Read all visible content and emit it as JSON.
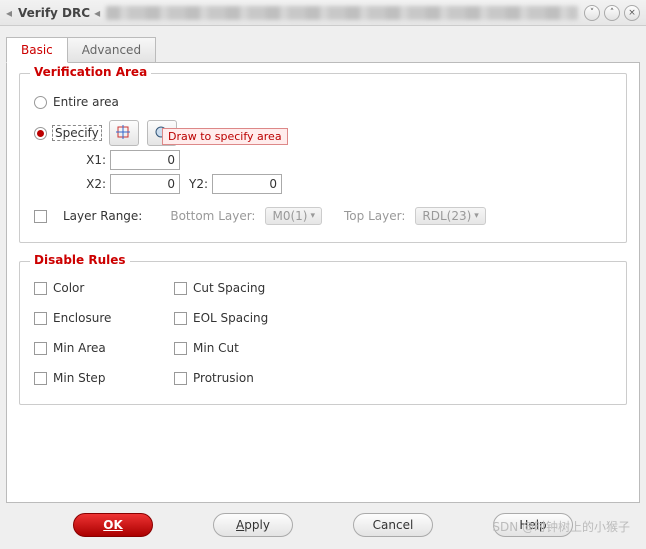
{
  "window": {
    "title": "Verify DRC"
  },
  "tabs": {
    "basic": "Basic",
    "advanced": "Advanced"
  },
  "verif": {
    "title": "Verification Area",
    "entire": "Entire area",
    "specify": "Specify",
    "tooltip": "Draw to specify area",
    "x1_label": "X1:",
    "x1": "0",
    "x2_label": "X2:",
    "x2": "0",
    "y2_label": "Y2:",
    "y2": "0",
    "layer_range": "Layer Range:",
    "bottom_label": "Bottom Layer:",
    "bottom_value": "M0(1)",
    "top_label": "Top Layer:",
    "top_value": "RDL(23)"
  },
  "rules": {
    "title": "Disable Rules",
    "items": [
      "Color",
      "Cut Spacing",
      "Enclosure",
      "EOL Spacing",
      "Min Area",
      "Min Cut",
      "Min Step",
      "Protrusion"
    ]
  },
  "buttons": {
    "ok": "OK",
    "apply": "Apply",
    "cancel": "Cancel",
    "help": "Help"
  },
  "watermark": "SDN @时钟树上的小猴子"
}
